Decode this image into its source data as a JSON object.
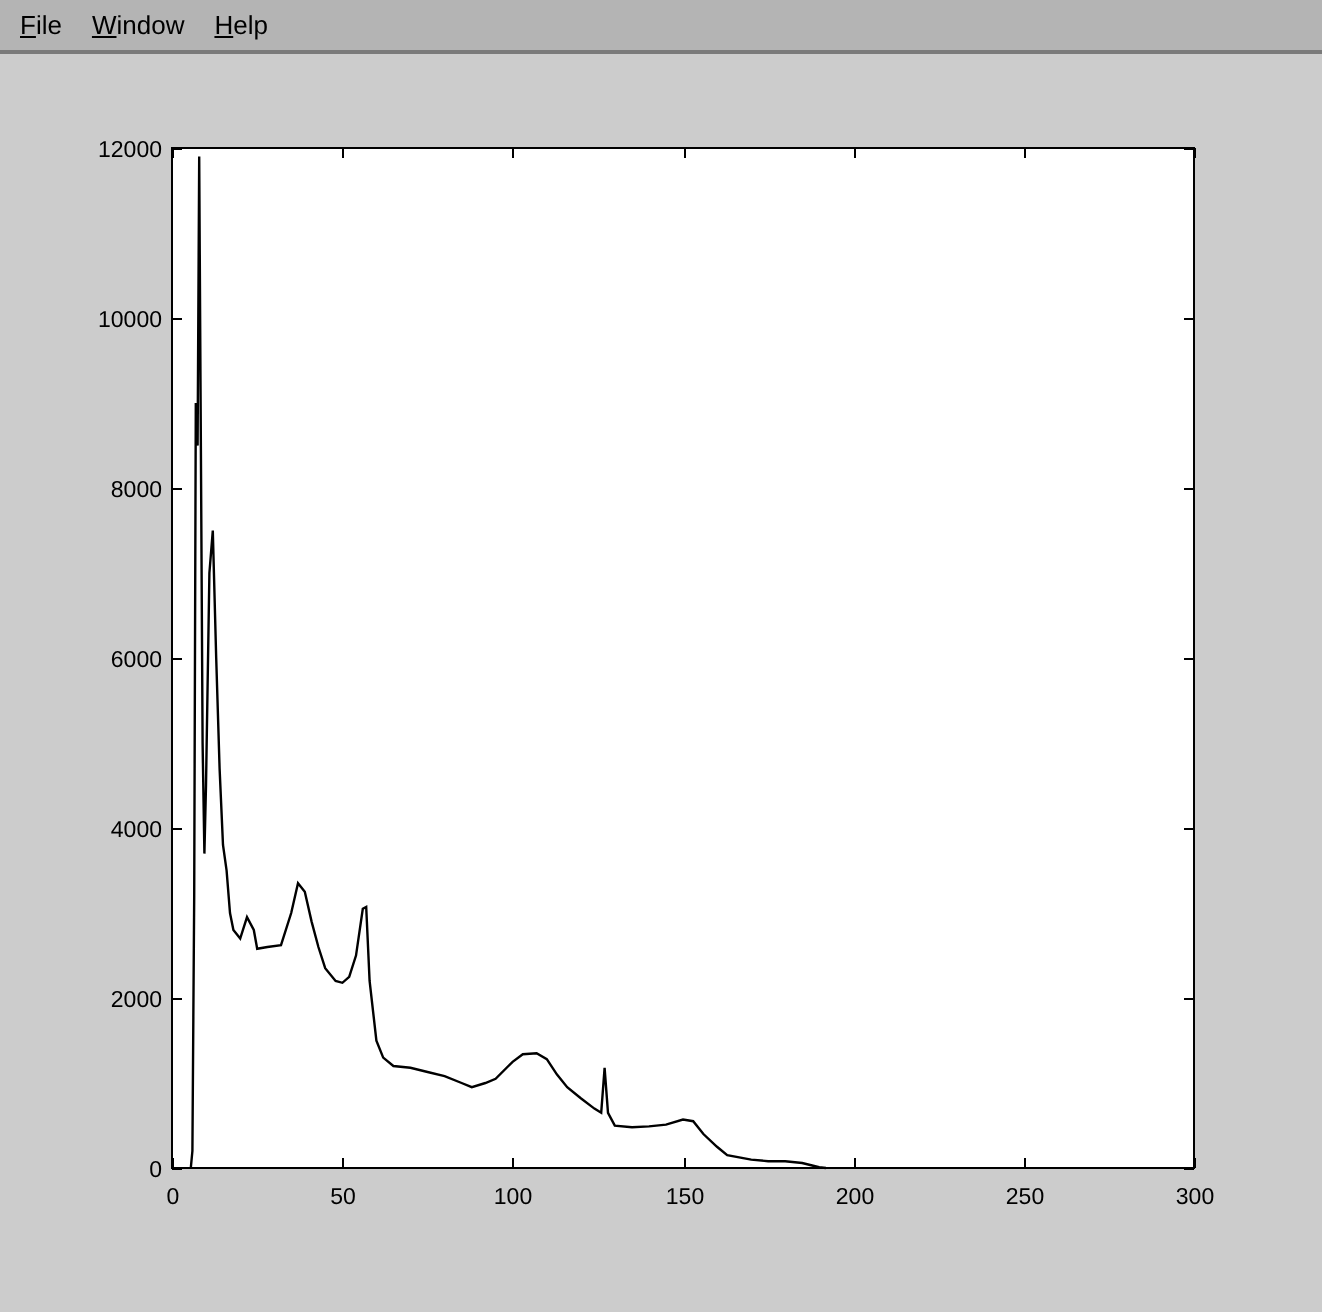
{
  "menu_bar": {
    "items": [
      {
        "label": "File"
      },
      {
        "label": "Window"
      },
      {
        "label": "Help"
      }
    ]
  },
  "plot": {
    "chart_data": {
      "type": "line",
      "xlim": [
        0,
        300
      ],
      "ylim": [
        0,
        12000
      ],
      "xticks": [
        0,
        50,
        100,
        150,
        200,
        250,
        300
      ],
      "yticks": [
        0,
        2000,
        4000,
        6000,
        8000,
        10000,
        12000
      ],
      "x": [
        5.5,
        6,
        6.5,
        7,
        7.5,
        8,
        9,
        9.5,
        10,
        11,
        12,
        13,
        14,
        15,
        16,
        17,
        18,
        20,
        22,
        24,
        25,
        28,
        32,
        35,
        37,
        39,
        41,
        43,
        45,
        48,
        50,
        52,
        54,
        56,
        57,
        58,
        60,
        62,
        65,
        70,
        75,
        80,
        85,
        88,
        92,
        95,
        100,
        103,
        107,
        110,
        113,
        116,
        120,
        124,
        126,
        127,
        128,
        130,
        135,
        140,
        145,
        150,
        153,
        156,
        160,
        163,
        170,
        175,
        180,
        185,
        190,
        192
      ],
      "series": [
        {
          "color": "#000000",
          "values": [
            0,
            200,
            3200,
            9000,
            8500,
            11900,
            5000,
            3700,
            4500,
            7000,
            7500,
            6000,
            4700,
            3800,
            3500,
            3000,
            2800,
            2700,
            2950,
            2800,
            2580,
            2600,
            2620,
            3000,
            3350,
            3250,
            2900,
            2600,
            2350,
            2200,
            2180,
            2250,
            2500,
            3050,
            3070,
            2200,
            1500,
            1300,
            1200,
            1180,
            1130,
            1080,
            1000,
            950,
            1000,
            1050,
            1250,
            1340,
            1350,
            1280,
            1100,
            950,
            820,
            700,
            650,
            1180,
            650,
            500,
            480,
            490,
            510,
            570,
            550,
            400,
            250,
            150,
            100,
            80,
            80,
            60,
            10,
            0
          ]
        }
      ]
    }
  }
}
